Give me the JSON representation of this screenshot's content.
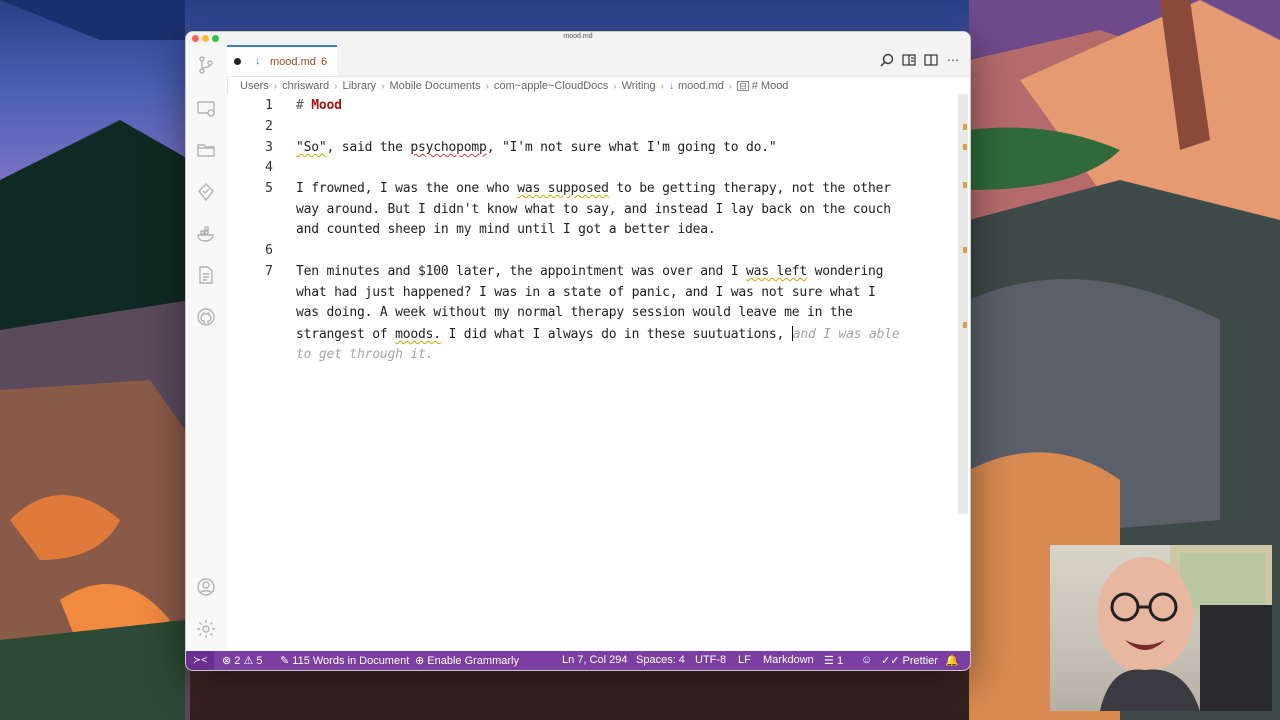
{
  "window": {
    "title": "mood.md"
  },
  "tab": {
    "label": "mood.md",
    "badge": "6"
  },
  "breadcrumb": [
    "Users",
    "chrisward",
    "Library",
    "Mobile Documents",
    "com~apple~CloudDocs",
    "Writing",
    "mood.md",
    "# Mood"
  ],
  "editor": {
    "line_numbers": [
      "1",
      "2",
      "3",
      "4",
      "5",
      "6",
      "7"
    ],
    "line1_hash": "#",
    "line1_heading": "Mood",
    "line3_a": "\"So\"",
    "line3_b": ", said the ",
    "line3_c": "psychopomp",
    "line3_d": ", \"I'm not sure what I'm going to do.\"",
    "line5_1a": "I frowned, I was the one who ",
    "line5_1b": "was supposed",
    "line5_1c": " to be getting therapy, not the other",
    "line5_2": "way around. But I didn't know what to say, and instead I lay back on the couch",
    "line5_3": "and counted sheep in my mind until I got a better idea.",
    "line7_1a": "Ten minutes and $100 later, the appointment was over and I ",
    "line7_1b": "was left",
    "line7_1c": " wondering",
    "line7_2": "what had just happened? I was in a state of panic, and I was not sure what I",
    "line7_3": "was doing. A week without my normal therapy session would leave me in the",
    "line7_4a": "strangest of ",
    "line7_4b": "moods.",
    "line7_4c": " I did what I always do in these suutuations, ",
    "line7_ghost1": "and I was able",
    "line7_ghost2": "to get through it."
  },
  "statusbar": {
    "errors": "2",
    "warnings": "5",
    "words": "115 Words in Document",
    "grammarly": "Enable Grammarly",
    "position": "Ln 7, Col 294",
    "spaces": "Spaces: 4",
    "encoding": "UTF-8",
    "eol": "LF",
    "language": "Markdown",
    "notifications": "1",
    "prettier": "Prettier"
  },
  "colors": {
    "statusbar": "#7a3fa0",
    "tab_accent": "#3a7fd5",
    "heading": "#a31515"
  }
}
